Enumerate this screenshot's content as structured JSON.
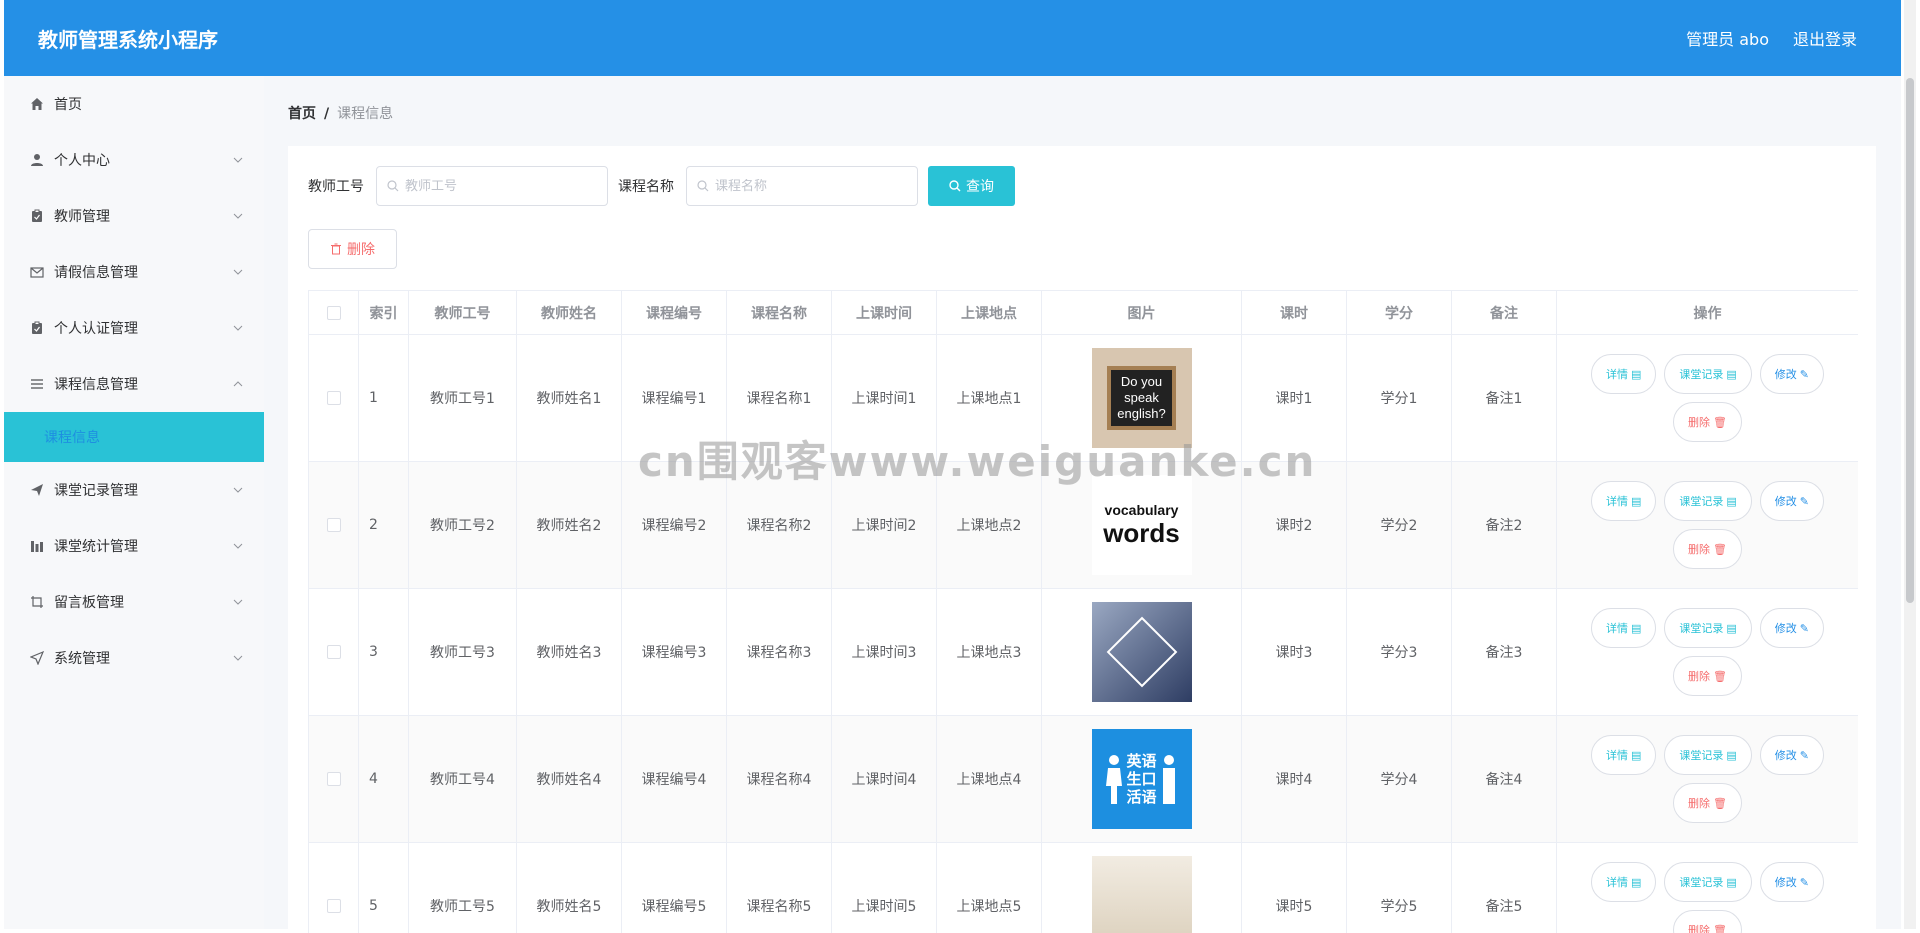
{
  "header": {
    "title": "教师管理系统小程序",
    "user": "管理员 abo",
    "logout": "退出登录"
  },
  "sidebar": {
    "items": [
      {
        "label": "首页",
        "icon": "home-icon",
        "chevron": false
      },
      {
        "label": "个人中心",
        "icon": "user-icon",
        "chevron": true
      },
      {
        "label": "教师管理",
        "icon": "clipboard-icon",
        "chevron": true
      },
      {
        "label": "请假信息管理",
        "icon": "mail-icon",
        "chevron": true
      },
      {
        "label": "个人认证管理",
        "icon": "clipboard-icon",
        "chevron": true
      },
      {
        "label": "课程信息管理",
        "icon": "list-icon",
        "chevron": true,
        "expanded": true
      },
      {
        "label": "课堂记录管理",
        "icon": "send-icon",
        "chevron": true
      },
      {
        "label": "课堂统计管理",
        "icon": "chart-icon",
        "chevron": true
      },
      {
        "label": "留言板管理",
        "icon": "crop-icon",
        "chevron": true
      },
      {
        "label": "系统管理",
        "icon": "location-icon",
        "chevron": true
      }
    ],
    "active_sub": "课程信息"
  },
  "breadcrumb": {
    "home": "首页",
    "sep": "/",
    "current": "课程信息"
  },
  "search": {
    "teacher_label": "教师工号",
    "teacher_placeholder": "教师工号",
    "course_label": "课程名称",
    "course_placeholder": "课程名称",
    "query_label": "查询"
  },
  "toolbar": {
    "delete_label": "删除"
  },
  "table": {
    "headers": [
      "索引",
      "教师工号",
      "教师姓名",
      "课程编号",
      "课程名称",
      "上课时间",
      "上课地点",
      "图片",
      "课时",
      "学分",
      "备注",
      "操作"
    ],
    "ops": {
      "detail": "详情",
      "record": "课堂记录",
      "edit": "修改",
      "delete": "删除"
    },
    "rows": [
      {
        "idx": "1",
        "teacher_no": "教师工号1",
        "teacher_name": "教师姓名1",
        "course_no": "课程编号1",
        "course_name": "课程名称1",
        "time": "上课时间1",
        "place": "上课地点1",
        "hours": "课时1",
        "credit": "学分1",
        "note": "备注1",
        "img_text": [
          "Do you",
          "speak",
          "english?"
        ]
      },
      {
        "idx": "2",
        "teacher_no": "教师工号2",
        "teacher_name": "教师姓名2",
        "course_no": "课程编号2",
        "course_name": "课程名称2",
        "time": "上课时间2",
        "place": "上课地点2",
        "hours": "课时2",
        "credit": "学分2",
        "note": "备注2",
        "img_text": [
          "vocabulary",
          "words"
        ]
      },
      {
        "idx": "3",
        "teacher_no": "教师工号3",
        "teacher_name": "教师姓名3",
        "course_no": "课程编号3",
        "course_name": "课程名称3",
        "time": "上课时间3",
        "place": "上课地点3",
        "hours": "课时3",
        "credit": "学分3",
        "note": "备注3",
        "img_text": []
      },
      {
        "idx": "4",
        "teacher_no": "教师工号4",
        "teacher_name": "教师姓名4",
        "course_no": "课程编号4",
        "course_name": "课程名称4",
        "time": "上课时间4",
        "place": "上课地点4",
        "hours": "课时4",
        "credit": "学分4",
        "note": "备注4",
        "img_text": [
          "英语",
          "生口",
          "活语"
        ]
      },
      {
        "idx": "5",
        "teacher_no": "教师工号5",
        "teacher_name": "教师姓名5",
        "course_no": "课程编号5",
        "course_name": "课程名称5",
        "time": "上课时间5",
        "place": "上课地点5",
        "hours": "课时5",
        "credit": "学分5",
        "note": "备注5",
        "img_text": []
      }
    ]
  },
  "watermark": "cn围观客www.weiguanke.cn",
  "colors": {
    "primary": "#2590e6",
    "accent": "#29c2d6",
    "danger": "#f56c6c"
  }
}
